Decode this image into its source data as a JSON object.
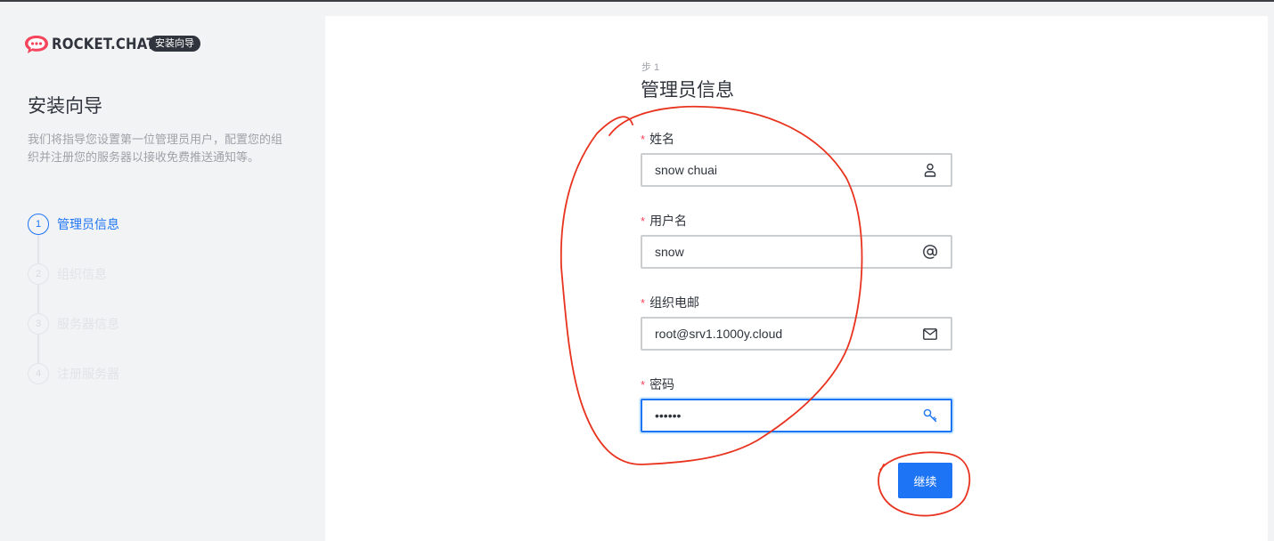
{
  "brand": {
    "logo_text": "ROCKET.CHAT",
    "badge": "安装向导"
  },
  "sidebar": {
    "title": "安装向导",
    "description": "我们将指导您设置第一位管理员用户，配置您的组织并注册您的服务器以接收免费推送通知等。",
    "steps": [
      {
        "num": "1",
        "label": "管理员信息",
        "active": true
      },
      {
        "num": "2",
        "label": "组织信息",
        "active": false
      },
      {
        "num": "3",
        "label": "服务器信息",
        "active": false
      },
      {
        "num": "4",
        "label": "注册服务器",
        "active": false
      }
    ]
  },
  "form": {
    "step_label": "步 1",
    "title": "管理员信息",
    "required_mark": "*",
    "fields": {
      "name": {
        "label": "姓名",
        "value": "snow chuai",
        "icon": "user-icon"
      },
      "username": {
        "label": "用户名",
        "value": "snow",
        "icon": "at-icon"
      },
      "email": {
        "label": "组织电邮",
        "value": "root@srv1.1000y.cloud",
        "icon": "mail-icon"
      },
      "password": {
        "label": "密码",
        "value": "••••••",
        "icon": "key-icon"
      }
    },
    "continue_label": "继续"
  },
  "colors": {
    "accent": "#1d74f5",
    "required": "#f5455c",
    "annotation": "#e8331f"
  }
}
